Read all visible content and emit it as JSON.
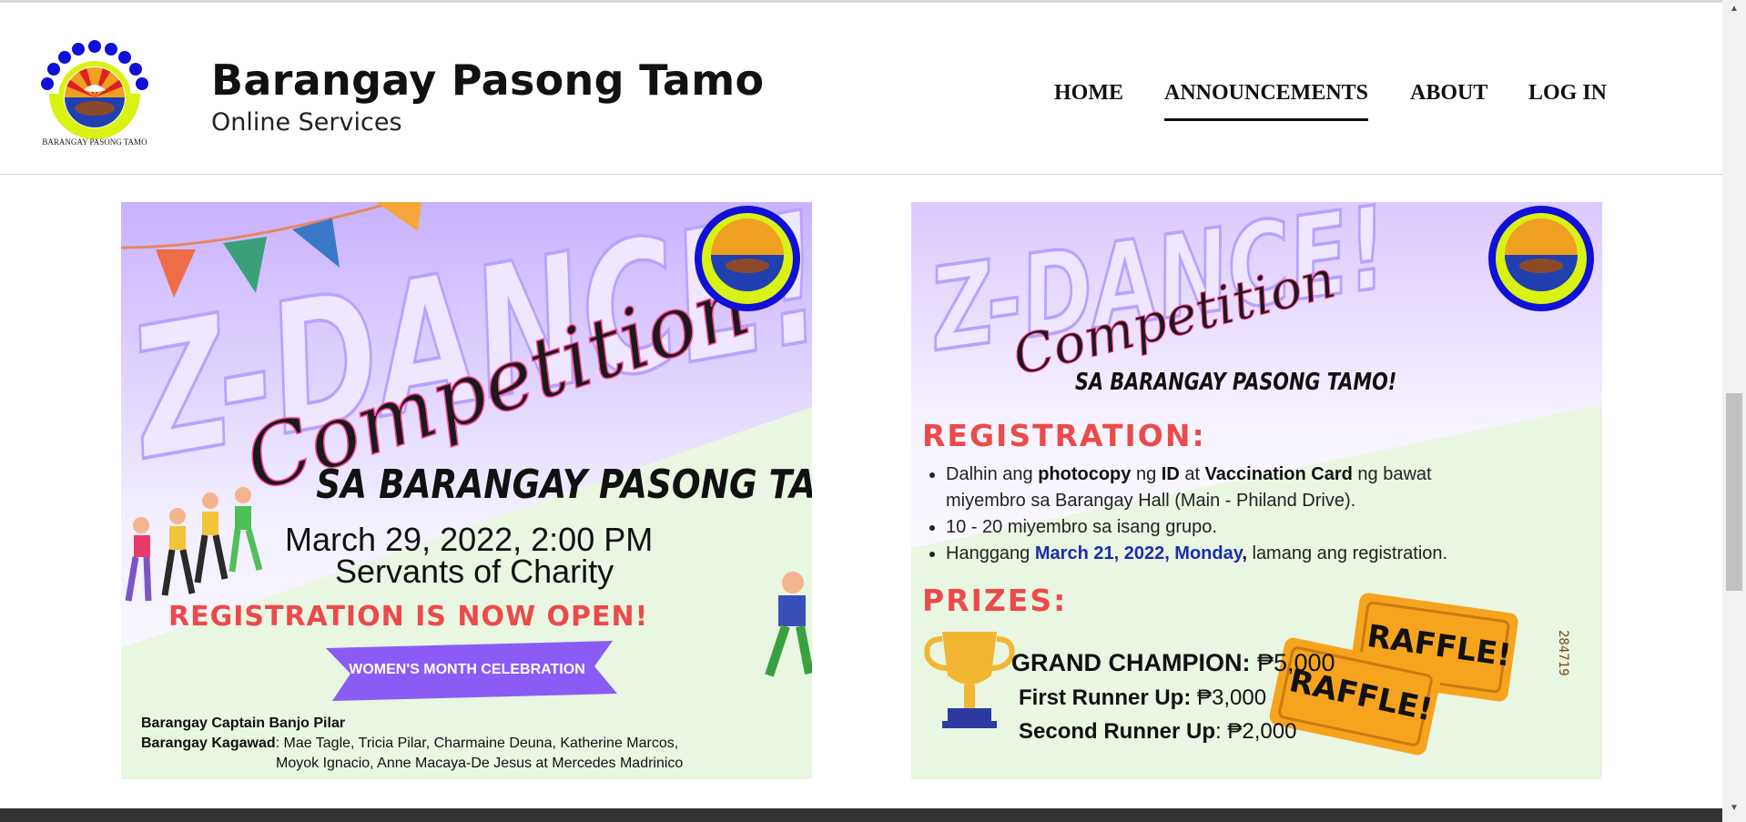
{
  "header": {
    "title": "Barangay Pasong Tamo",
    "subtitle": "Online Services",
    "logo_text": "BARANGAY PASONG TAMO"
  },
  "nav": {
    "items": [
      {
        "label": "HOME"
      },
      {
        "label": "ANNOUNCEMENTS",
        "active": true
      },
      {
        "label": "ABOUT"
      },
      {
        "label": "LOG IN"
      }
    ]
  },
  "poster1": {
    "headline": "Z-DANCE!",
    "script": "Competition",
    "subheadline": "SA BARANGAY PASONG TAMO!",
    "date": "March 29, 2022, 2:00 PM",
    "venue": "Servants of Charity",
    "registration": "REGISTRATION IS NOW OPEN!",
    "ribbon": "WOMEN'S MONTH CELEBRATION",
    "captain": "Barangay Captain Banjo Pilar",
    "kagawad_label": "Barangay Kagawad",
    "kagawad_names_1": ": Mae Tagle, Tricia Pilar, Charmaine Deuna, Katherine Marcos,",
    "kagawad_names_2": "Moyok Ignacio, Anne Macaya-De Jesus at Mercedes Madrinico"
  },
  "poster2": {
    "headline": "Z-DANCE!",
    "script": "Competition",
    "subheadline": "SA BARANGAY PASONG TAMO!",
    "registration_heading": "REGISTRATION:",
    "item1_a": "Dalhin ang ",
    "item1_b": "photocopy",
    "item1_c": " ng ",
    "item1_d": "ID",
    "item1_e": " at ",
    "item1_f": "Vaccination Card",
    "item1_g": " ng bawat miyembro sa Barangay Hall (Main - Philand Drive).",
    "item2": "10 - 20 miyembro sa isang grupo.",
    "item3_a": " Hanggang ",
    "item3_b": "March 21, 2022, Monday",
    "item3_c": ",",
    "item3_d": " lamang ang registration.",
    "prizes_heading": "PRIZES:",
    "grand_label": "GRAND CHAMPION:",
    "grand_value": " ₱5,000",
    "first_label": "First Runner Up:",
    "first_value": " ₱3,000",
    "second_label": "Second Runner Up",
    "second_value": ": ₱2,000",
    "raffle": "RAFFLE!",
    "ticket_no": "284719"
  },
  "colors": {
    "accent_red": "#ec4a4a",
    "ribbon_purple": "#8a5cf5",
    "headline_lavender": "#efe7ff",
    "footer_dark": "#343434"
  }
}
